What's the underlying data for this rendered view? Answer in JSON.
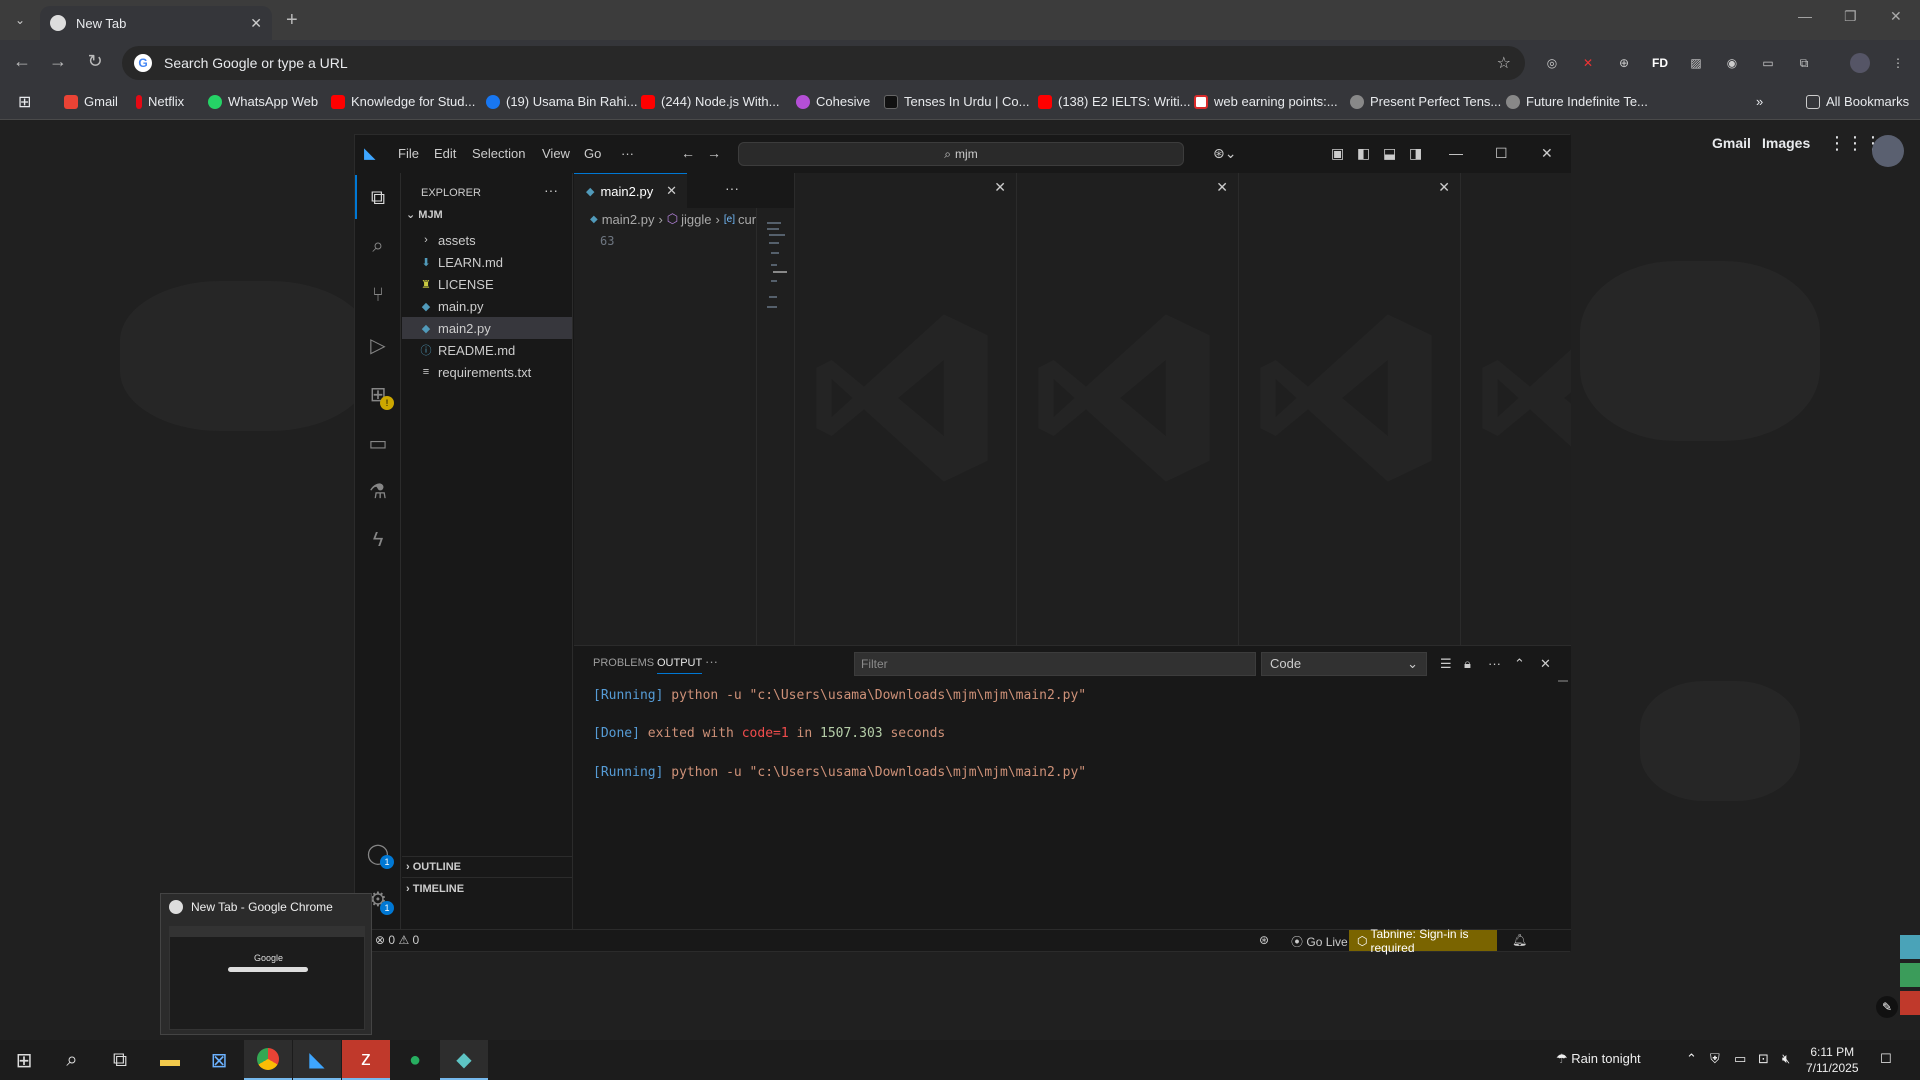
{
  "chrome": {
    "tab_title": "New Tab",
    "omnibox_placeholder": "Search Google or type a URL",
    "bookmarks": [
      {
        "label": "Gmail",
        "color": "#ea4335"
      },
      {
        "label": "Netflix",
        "color": "#e50914"
      },
      {
        "label": "WhatsApp Web",
        "color": "#25d366"
      },
      {
        "label": "Knowledge for Stud...",
        "color": "#ff0000"
      },
      {
        "label": "(19) Usama Bin Rahi...",
        "color": "#1877f2"
      },
      {
        "label": "(244) Node.js With...",
        "color": "#ff0000"
      },
      {
        "label": "Cohesive",
        "color": "#b44fd6"
      },
      {
        "label": "Tenses In Urdu | Co...",
        "color": "#222222"
      },
      {
        "label": "(138) E2 IELTS: Writi...",
        "color": "#ff0000"
      },
      {
        "label": "web earning points:...",
        "color": "#d92a2a"
      },
      {
        "label": "Present Perfect Tens...",
        "color": "#888888"
      },
      {
        "label": "Future Indefinite Te...",
        "color": "#888888"
      }
    ],
    "all_bookmarks": "All Bookmarks",
    "extension_labels": {
      "fd": "FD"
    }
  },
  "google": {
    "gmail": "Gmail",
    "images": "Images"
  },
  "vscode": {
    "menus": [
      "File",
      "Edit",
      "Selection",
      "View",
      "Go",
      "···"
    ],
    "command_center": "mjm",
    "explorer_title": "EXPLORER",
    "root_folder": "MJM",
    "files": [
      {
        "name": "assets",
        "icon": "chevron-right-icon",
        "glyph": "›",
        "color": "#cccccc"
      },
      {
        "name": "LEARN.md",
        "icon": "markdown-icon",
        "glyph": "⬇",
        "color": "#519aba"
      },
      {
        "name": "LICENSE",
        "icon": "license-icon",
        "glyph": "♜",
        "color": "#cbcb41"
      },
      {
        "name": "main.py",
        "icon": "python-icon",
        "glyph": "◆",
        "color": "#519aba"
      },
      {
        "name": "main2.py",
        "icon": "python-icon",
        "glyph": "◆",
        "color": "#519aba",
        "selected": true
      },
      {
        "name": "README.md",
        "icon": "info-icon",
        "glyph": "ⓘ",
        "color": "#519aba"
      },
      {
        "name": "requirements.txt",
        "icon": "text-file-icon",
        "glyph": "≡",
        "color": "#cccccc"
      }
    ],
    "outline": "OUTLINE",
    "timeline": "TIMELINE",
    "active_tab": "main2.py",
    "breadcrumb": {
      "file": "main2.py",
      "symbol": "jiggle",
      "member": "curre"
    },
    "line_number": "63",
    "panel_tabs": {
      "problems": "PROBLEMS",
      "output": "OUTPUT"
    },
    "filter_placeholder": "Filter",
    "output_channel": "Code",
    "output_lines": {
      "l1_tag": "[Running]",
      "l1_cmd": " python -u \"c:\\Users\\usama\\Downloads\\mjm\\mjm\\main2.py\"",
      "l2_tag": "[Done]",
      "l2_a": " exited with ",
      "l2_code": "code=1",
      "l2_b": " in ",
      "l2_num": "1507.303",
      "l2_c": " seconds",
      "l3_tag": "[Running]",
      "l3_cmd": " python -u \"c:\\Users\\usama\\Downloads\\mjm\\mjm\\main2.py\""
    },
    "status": {
      "errors": "0",
      "warnings": "0",
      "go_live": "Go Live",
      "tabnine": "Tabnine: Sign-in is required"
    },
    "badges": {
      "accounts": "1",
      "manage": "1"
    }
  },
  "preview": {
    "title": "New Tab - Google Chrome",
    "thumb_text": "Google"
  },
  "taskbar": {
    "weather": "Rain tonight",
    "time": "6:11 PM",
    "date": "7/11/2025"
  },
  "colors": {
    "accent": "#0078d4",
    "tabnine_bg": "#7a6400"
  }
}
